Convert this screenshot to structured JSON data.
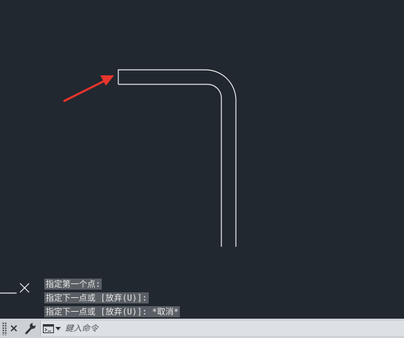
{
  "command_history": [
    "指定第一个点:",
    "指定下一点或 [放弃(U)]:",
    "指定下一点或 [放弃(U)]: *取消*"
  ],
  "command_line": {
    "placeholder": "鍵入命令"
  },
  "colors": {
    "canvas_background": "#212830",
    "geometry": "#ffffff",
    "arrow": "#e8342c",
    "history_background": "#5a5f65",
    "command_bar": "#cdd1d6"
  },
  "icons": {
    "close": "close-icon",
    "customize": "wrench-icon",
    "command_window": "command-prompt-icon",
    "recent_commands": "chevron-down-icon",
    "crosshair": "crosshair-cursor-icon",
    "grip": "grip-handle-icon"
  }
}
